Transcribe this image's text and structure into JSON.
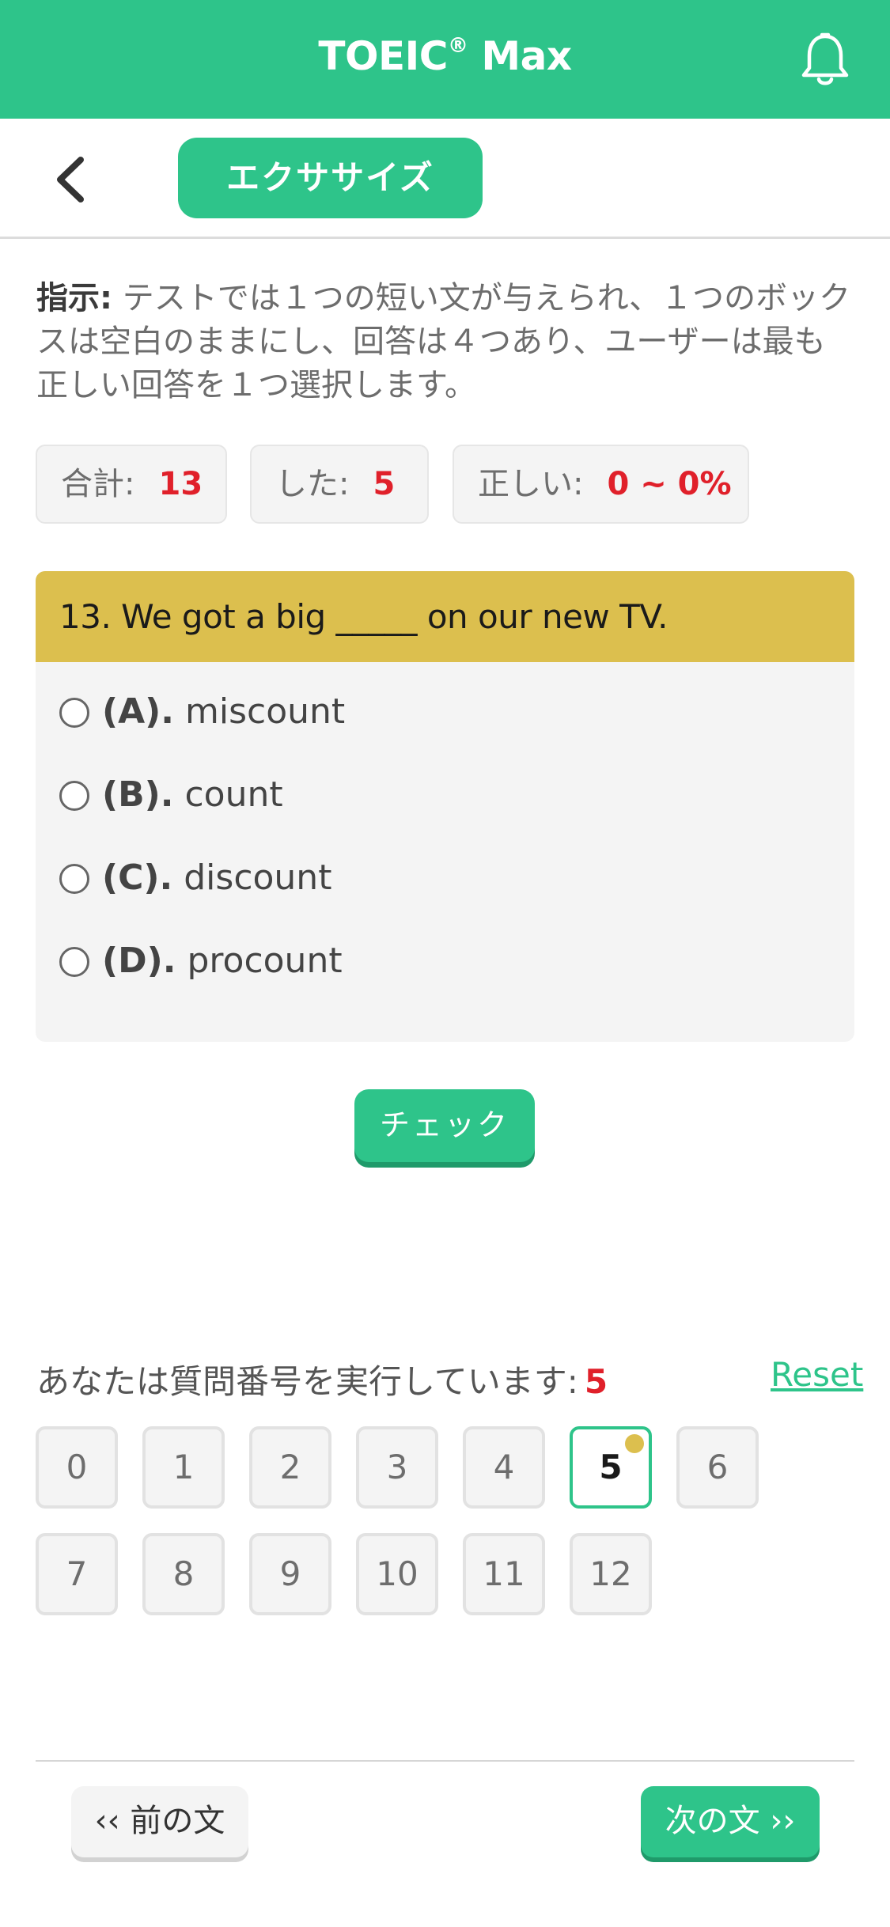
{
  "header": {
    "app_name": "TOEIC",
    "registered_mark": "®",
    "app_suffix": "Max",
    "bell_icon": "bell-icon"
  },
  "subnav": {
    "back_icon": "chevron-left-icon",
    "tab_label": "エクササイズ"
  },
  "instructions": {
    "prefix": "指示:",
    "text": " テストでは１つの短い文が与えられ、１つのボックスは空白のままにし、回答は４つあり、ユーザーは最も正しい回答を１つ選択します。"
  },
  "stats": {
    "total_label": "合計:",
    "total_value": "13",
    "done_label": "した:",
    "done_value": "5",
    "correct_label": "正しい:",
    "correct_value": "0 ~ 0%"
  },
  "question": {
    "text": "13. We got a big _____ on our new TV.",
    "options": [
      {
        "letter": "(A).",
        "text": "miscount"
      },
      {
        "letter": "(B).",
        "text": "count"
      },
      {
        "letter": "(C).",
        "text": "discount"
      },
      {
        "letter": "(D).",
        "text": "procount"
      }
    ]
  },
  "check_label": "チェック",
  "progress": {
    "label": "あなたは質問番号を実行しています:",
    "current": "5",
    "reset_label": "Reset",
    "numbers": [
      "0",
      "1",
      "2",
      "3",
      "4",
      "5",
      "6",
      "7",
      "8",
      "9",
      "10",
      "11",
      "12"
    ]
  },
  "footer": {
    "prev_label": "‹‹ 前の文",
    "next_label": "次の文 ››"
  },
  "colors": {
    "accent": "#2ec48a",
    "question_header": "#dcbf4e",
    "stat_value": "#e0202a"
  }
}
